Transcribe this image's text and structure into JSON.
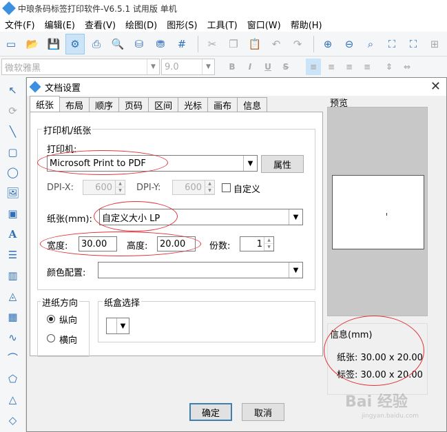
{
  "app": {
    "title": "中琅条码标签打印软件-V6.5.1 试用版 单机"
  },
  "menu": [
    "文件(F)",
    "编辑(E)",
    "查看(V)",
    "绘图(D)",
    "图形(S)",
    "工具(T)",
    "窗口(W)",
    "帮助(H)"
  ],
  "format_bar": {
    "font": "微软雅黑",
    "size": "9.0",
    "bold": "B",
    "italic": "I",
    "underline": "U",
    "strike": "S"
  },
  "dialog": {
    "title": "文档设置",
    "tabs": [
      "纸张",
      "布局",
      "顺序",
      "页码",
      "区间",
      "光标",
      "画布",
      "信息"
    ],
    "active_tab": "纸张",
    "printer_group": "打印机/纸张",
    "printer_label": "打印机:",
    "printer_value": "Microsoft Print to PDF",
    "properties_button": "属性",
    "dpi_x_label": "DPI-X:",
    "dpi_x_value": "600",
    "dpi_y_label": "DPI-Y:",
    "dpi_y_value": "600",
    "custom_label": "自定义",
    "paper_label": "纸张(mm):",
    "paper_value": "自定义大小 LP",
    "width_label": "宽度:",
    "width_value": "30.00",
    "height_label": "高度:",
    "height_value": "20.00",
    "copies_label": "份数:",
    "copies_value": "1",
    "color_label": "颜色配置:",
    "color_value": "",
    "feed_group": "进纸方向",
    "portrait_label": "纵向",
    "landscape_label": "横向",
    "tray_group": "纸盒选择",
    "preview_label": "预览",
    "info_label": "信息(mm)",
    "info_paper": "纸张: 30.00 x 20.00",
    "info_label_size": "标签: 30.00 x 20.00",
    "ok_button": "确定",
    "cancel_button": "取消"
  },
  "watermark": {
    "text": "Bai 经验",
    "sub": "jingyan.baidu.com"
  },
  "colors": {
    "highlight_ellipse": "#e0323a",
    "accent": "#2d6fb8"
  }
}
